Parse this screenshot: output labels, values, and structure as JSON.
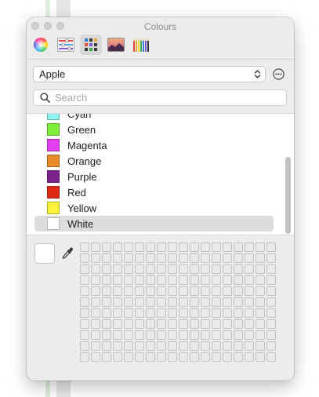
{
  "window": {
    "title": "Colours"
  },
  "toolbar": {
    "tabs": [
      {
        "icon": "colour-wheel-icon"
      },
      {
        "icon": "colour-sliders-icon"
      },
      {
        "icon": "colour-palettes-icon",
        "active": true
      },
      {
        "icon": "image-palettes-icon"
      },
      {
        "icon": "pencils-icon"
      }
    ]
  },
  "palette_select": {
    "value": "Apple",
    "icon": "chevron-updown-icon"
  },
  "more_button": {
    "icon": "ellipsis-circle-icon"
  },
  "search": {
    "placeholder": "Search",
    "icon": "magnifier-icon"
  },
  "colour_list": {
    "items": [
      {
        "label": "Cyan",
        "color": "#8ff5f0"
      },
      {
        "label": "Green",
        "color": "#7ff03a"
      },
      {
        "label": "Magenta",
        "color": "#e23ff0"
      },
      {
        "label": "Orange",
        "color": "#e8892a"
      },
      {
        "label": "Purple",
        "color": "#7a228a"
      },
      {
        "label": "Red",
        "color": "#de2a15"
      },
      {
        "label": "Yellow",
        "color": "#fbf33a"
      },
      {
        "label": "White",
        "color": "#ffffff",
        "selected": true
      }
    ]
  },
  "current_colour": {
    "color": "#ffffff"
  },
  "eyedropper": {
    "icon": "eyedropper-icon"
  },
  "swatch_grid": {
    "rows": 11,
    "columns": 18
  }
}
